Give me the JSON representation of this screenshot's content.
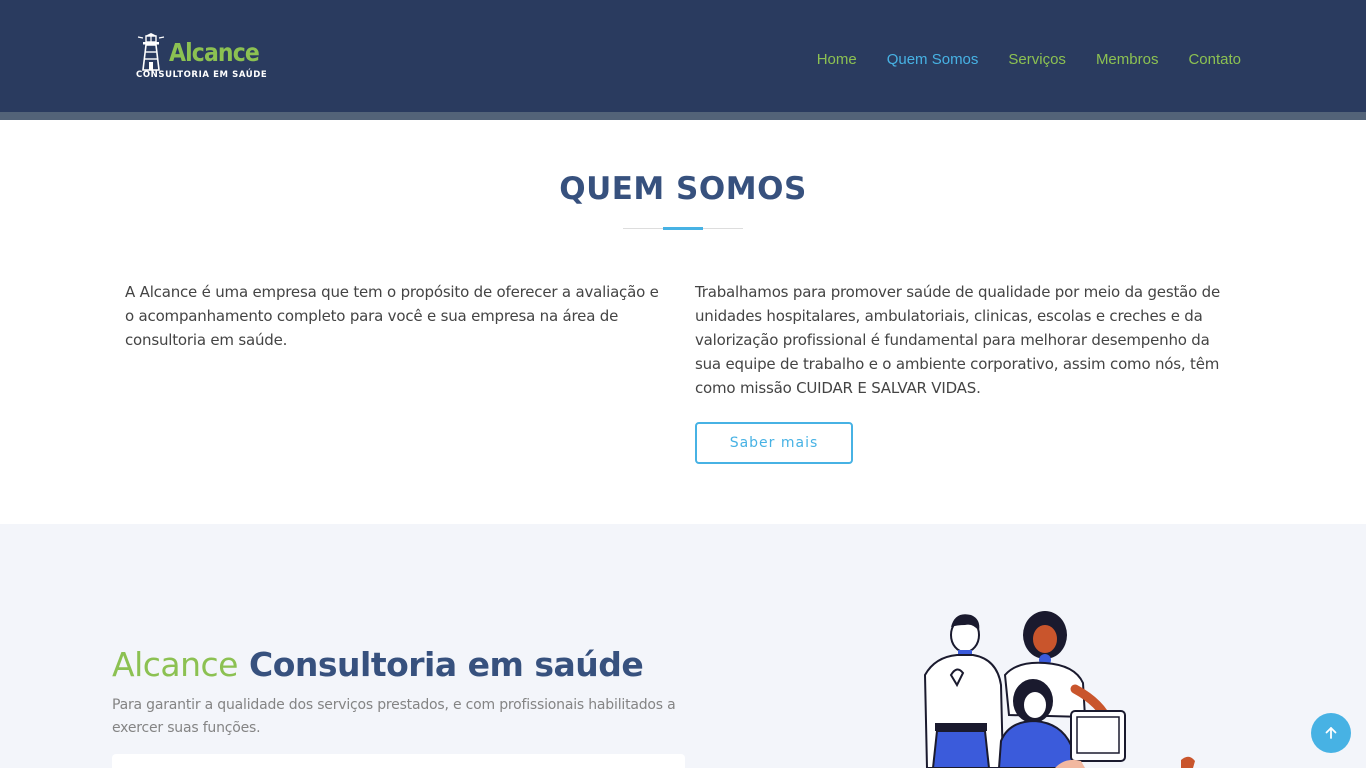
{
  "header": {
    "logo_word": "Alcance",
    "logo_sub": "CONSULTORIA EM SAÚDE",
    "nav": [
      {
        "label": "Home",
        "active": false
      },
      {
        "label": "Quem Somos",
        "active": true
      },
      {
        "label": "Serviços",
        "active": false
      },
      {
        "label": "Membros",
        "active": false
      },
      {
        "label": "Contato",
        "active": false
      }
    ]
  },
  "about": {
    "title": "QUEM SOMOS",
    "left_text": "A Alcance é uma empresa que tem o propósito de oferecer a avaliação e o acompanhamento completo para você e sua empresa na área de consultoria em saúde.",
    "right_text": "Trabalhamos para promover saúde de qualidade por meio da gestão de unidades hospitalares, ambulatoriais, clinicas, escolas e creches e da valorização profissional é fundamental para melhorar desempenho da sua equipe de trabalho e o ambiente corporativo, assim como nós, têm como missão CUIDAR E SALVAR VIDAS.",
    "button_label": "Saber mais"
  },
  "why_us": {
    "title_light": "Alcance",
    "title_bold": "Consultoria em saúde",
    "text": "Para garantir a qualidade dos serviços prestados, e com profissionais habilitados a exercer suas funções."
  },
  "icons": {
    "logo": "lighthouse-icon",
    "back_to_top": "arrow-up-icon",
    "illustration": "team-illustration"
  },
  "colors": {
    "header_bg": "#2a3b5f",
    "brand_green": "#8cc152",
    "accent_blue": "#47b2e4",
    "title_navy": "#37517e",
    "section_bg": "#f3f5fa"
  }
}
